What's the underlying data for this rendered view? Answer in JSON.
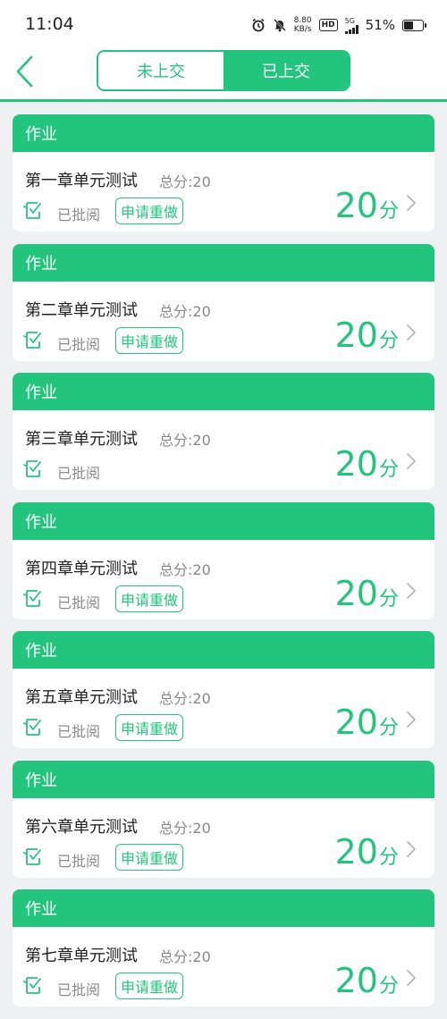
{
  "status_bar": {
    "time": "11:04",
    "net_speed_value": "8.80",
    "net_speed_unit": "KB/s",
    "hd_label": "HD",
    "network_type": "5G",
    "battery_percent": "51%",
    "battery_level": 0.51
  },
  "header": {
    "tabs": [
      {
        "label": "未上交",
        "active": false
      },
      {
        "label": "已上交",
        "active": true
      }
    ]
  },
  "assignments": [
    {
      "header": "作业",
      "title": "第一章单元测试",
      "total": "总分:20",
      "status": "已批阅",
      "redo_label": "申请重做",
      "has_redo": true,
      "score": "20",
      "score_unit": "分"
    },
    {
      "header": "作业",
      "title": "第二章单元测试",
      "total": "总分:20",
      "status": "已批阅",
      "redo_label": "申请重做",
      "has_redo": true,
      "score": "20",
      "score_unit": "分"
    },
    {
      "header": "作业",
      "title": "第三章单元测试",
      "total": "总分:20",
      "status": "已批阅",
      "redo_label": "",
      "has_redo": false,
      "score": "20",
      "score_unit": "分"
    },
    {
      "header": "作业",
      "title": "第四章单元测试",
      "total": "总分:20",
      "status": "已批阅",
      "redo_label": "申请重做",
      "has_redo": true,
      "score": "20",
      "score_unit": "分"
    },
    {
      "header": "作业",
      "title": "第五章单元测试",
      "total": "总分:20",
      "status": "已批阅",
      "redo_label": "申请重做",
      "has_redo": true,
      "score": "20",
      "score_unit": "分"
    },
    {
      "header": "作业",
      "title": "第六章单元测试",
      "total": "总分:20",
      "status": "已批阅",
      "redo_label": "申请重做",
      "has_redo": true,
      "score": "20",
      "score_unit": "分"
    },
    {
      "header": "作业",
      "title": "第七章单元测试",
      "total": "总分:20",
      "status": "已批阅",
      "redo_label": "申请重做",
      "has_redo": true,
      "score": "20",
      "score_unit": "分"
    }
  ],
  "colors": {
    "accent": "#22c47e",
    "background": "#eef0f2",
    "muted_text": "#8a8a8a"
  }
}
